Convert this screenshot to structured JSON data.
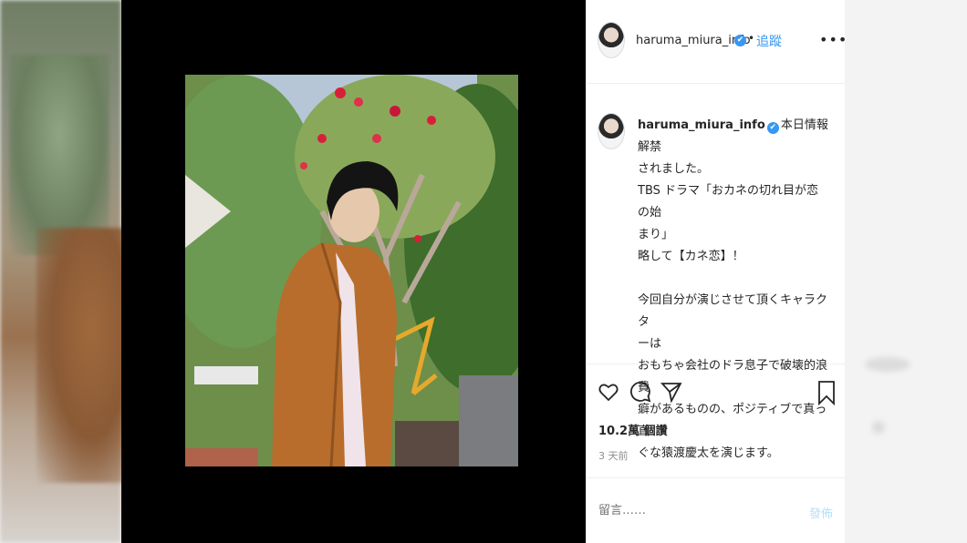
{
  "post": {
    "username": "haruma_miura_info",
    "verified_mark": "✔",
    "follow_separator": "•",
    "follow_label": "追蹤",
    "more_label": "•••",
    "caption_username": "haruma_miura_info",
    "caption_text": " 本日情報解禁\nされました。\nTBS ドラマ「おカネの切れ目が恋の始\nまり」\n略して【カネ恋】！\n\n今回自分が演じさせて頂くキャラクタ\nーは\nおもちゃ会社のドラ息子で破壊的浪費\n癖があるものの、ポジティブで真っ直\nぐな猿渡慶太を演じます。",
    "likes": "10.2萬 個讚",
    "time_ago": "3 天前",
    "comment_placeholder": "留言……",
    "post_button": "發佈"
  },
  "icons": {
    "like": "heart-icon",
    "comment": "comment-icon",
    "share": "share-icon",
    "save": "bookmark-icon",
    "verified": "verified-badge-icon"
  },
  "colors": {
    "accent": "#3897f0",
    "text": "#262626",
    "muted": "#8e8e8e",
    "post_disabled": "#b2dffc",
    "media_bg": "#000000"
  }
}
